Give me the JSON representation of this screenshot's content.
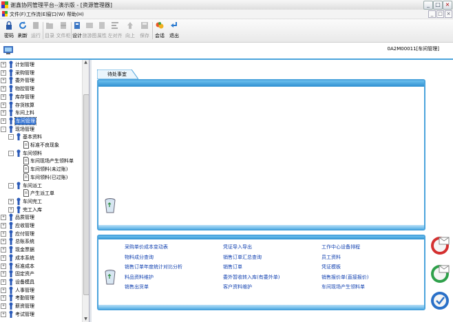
{
  "window": {
    "title": "谢鑫协同管理平台--演示版 - [资源管理器]",
    "buttons": [
      "_",
      "□",
      "×"
    ]
  },
  "menu": {
    "items": [
      "文件(F)",
      "工作流(E)",
      "窗口(W)",
      "帮助(H)"
    ],
    "mdi_buttons": [
      "_",
      "□",
      "×"
    ]
  },
  "toolbar": {
    "buttons": [
      {
        "label": "密码",
        "icon": "lock-icon",
        "enabled": true
      },
      {
        "label": "刷新",
        "icon": "refresh-icon",
        "enabled": true
      },
      {
        "label": "运行",
        "icon": "run-icon",
        "enabled": false
      },
      {
        "label": "目录",
        "icon": "folder-icon",
        "enabled": false
      },
      {
        "label": "文件柜",
        "icon": "cabinet-icon",
        "enabled": false
      },
      {
        "label": "设计",
        "icon": "design-icon",
        "enabled": true
      },
      {
        "label": "旅游图",
        "icon": "map-icon",
        "enabled": false
      },
      {
        "label": "属性",
        "icon": "properties-icon",
        "enabled": false
      },
      {
        "label": "左对齐",
        "icon": "align-left-icon",
        "enabled": false
      },
      {
        "label": "向上",
        "icon": "up-icon",
        "enabled": false
      },
      {
        "label": "保存",
        "icon": "save-icon",
        "enabled": false
      },
      {
        "label": "会话",
        "icon": "chat-icon",
        "enabled": true
      },
      {
        "label": "退出",
        "icon": "exit-icon",
        "enabled": true
      }
    ]
  },
  "header": {
    "user_label": "0A2M00011[车间管理]"
  },
  "tree": [
    {
      "label": "计划管理",
      "level": 0,
      "pm": "+"
    },
    {
      "label": "采购管理",
      "level": 0,
      "pm": "+"
    },
    {
      "label": "委外管理",
      "level": 0,
      "pm": "+"
    },
    {
      "label": "物控管理",
      "level": 0,
      "pm": "+"
    },
    {
      "label": "库存管理",
      "level": 0,
      "pm": "+"
    },
    {
      "label": "存货核算",
      "level": 0,
      "pm": "+"
    },
    {
      "label": "车间上料",
      "level": 0,
      "pm": "+"
    },
    {
      "label": "车间管理",
      "level": 0,
      "pm": "+",
      "selected": true
    },
    {
      "label": "现场管理",
      "level": 0,
      "pm": "-"
    },
    {
      "label": "基本资料",
      "level": 1,
      "pm": "-"
    },
    {
      "label": "标准不良现象",
      "level": 2,
      "pm": ""
    },
    {
      "label": "车间领料",
      "level": 1,
      "pm": "-"
    },
    {
      "label": "车间现场产生领料单",
      "level": 2,
      "pm": ""
    },
    {
      "label": "车间领料(未过账)",
      "level": 2,
      "pm": ""
    },
    {
      "label": "车间领料(已过账)",
      "level": 2,
      "pm": ""
    },
    {
      "label": "车间派工",
      "level": 1,
      "pm": "-"
    },
    {
      "label": "产生派工单",
      "level": 2,
      "pm": ""
    },
    {
      "label": "车间完工",
      "level": 1,
      "pm": "+"
    },
    {
      "label": "完工入库",
      "level": 1,
      "pm": "+"
    },
    {
      "label": "品质管理",
      "level": 0,
      "pm": "+"
    },
    {
      "label": "应收管理",
      "level": 0,
      "pm": "+"
    },
    {
      "label": "应付管理",
      "level": 0,
      "pm": "+"
    },
    {
      "label": "总账系统",
      "level": 0,
      "pm": "+"
    },
    {
      "label": "现金票据",
      "level": 0,
      "pm": "+"
    },
    {
      "label": "成本系统",
      "level": 0,
      "pm": "+"
    },
    {
      "label": "标准成本",
      "level": 0,
      "pm": "+"
    },
    {
      "label": "固定资产",
      "level": 0,
      "pm": "+"
    },
    {
      "label": "设备模具",
      "level": 0,
      "pm": "+"
    },
    {
      "label": "人事管理",
      "level": 0,
      "pm": "+"
    },
    {
      "label": "考勤管理",
      "level": 0,
      "pm": "+"
    },
    {
      "label": "薪资管理",
      "level": 0,
      "pm": "+"
    },
    {
      "label": "考试管理",
      "level": 0,
      "pm": "+"
    }
  ],
  "content": {
    "tab_label": "待处事宜",
    "shortcuts": [
      [
        "采购单价成本变动表",
        "凭证导入导出",
        "工作中心设备排程"
      ],
      [
        "物料成分查询",
        "销售订单汇总查询",
        "员工资料"
      ],
      [
        "销售订单年度统计对比分析",
        "销售订单",
        "凭证模板"
      ],
      [
        "料品资料维护",
        "委外暂收转入库(有委外单)",
        "销售报价单(直接报价)"
      ],
      [
        "销售出货单",
        "客户资料维护",
        "车间现场产生领料单"
      ]
    ],
    "right_icons": [
      "mail-icon",
      "refresh-mail-icon",
      "check-icon"
    ]
  },
  "colors": {
    "accent": "#4aa3dc",
    "link": "#1040b0",
    "selected": "#2f6fd0"
  }
}
